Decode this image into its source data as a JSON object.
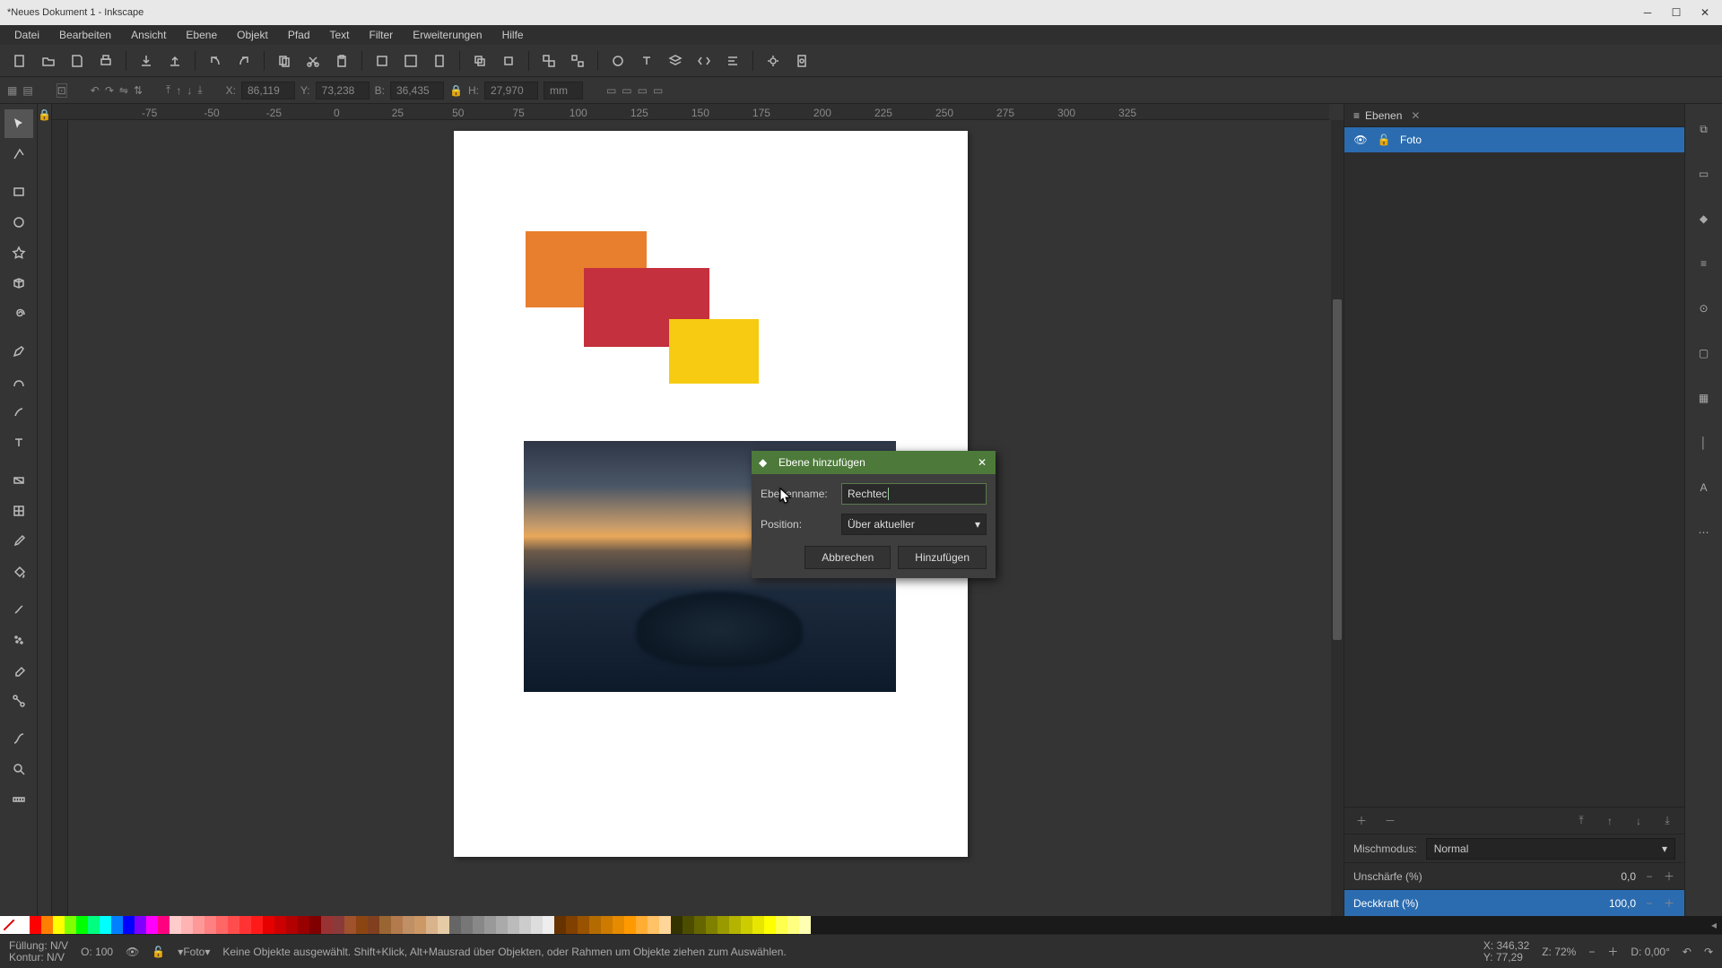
{
  "titlebar": {
    "title": "*Neues Dokument 1 - Inkscape"
  },
  "menubar": [
    "Datei",
    "Bearbeiten",
    "Ansicht",
    "Ebene",
    "Objekt",
    "Pfad",
    "Text",
    "Filter",
    "Erweiterungen",
    "Hilfe"
  ],
  "tooloptions": {
    "x_label": "X:",
    "x": "86,119",
    "y_label": "Y:",
    "y": "73,238",
    "w_label": "B:",
    "w": "36,435",
    "h_label": "H:",
    "h": "27,970",
    "unit": "mm"
  },
  "dialog": {
    "title": "Ebene hinzufügen",
    "name_label": "Ebenenname:",
    "name_value": "Rechtec",
    "pos_label": "Position:",
    "pos_value": "Über aktueller",
    "cancel": "Abbrechen",
    "ok": "Hinzufügen"
  },
  "layers_panel": {
    "tab": "Ebenen",
    "layer_name": "Foto",
    "blend_label": "Mischmodus:",
    "blend_value": "Normal",
    "blur_label": "Unschärfe (%)",
    "blur_value": "0,0",
    "opacity_label": "Deckkraft (%)",
    "opacity_value": "100,0"
  },
  "statusbar": {
    "fill_label": "Füllung:",
    "stroke_label": "Kontur:",
    "nv": "N/V",
    "o_label": "O:",
    "o_val": "100",
    "layer_sel": "▾Foto▾",
    "hint": "Keine Objekte ausgewählt. Shift+Klick, Alt+Mausrad über Objekten, oder Rahmen um Objekte ziehen zum Auswählen.",
    "coord_x_lbl": "X:",
    "coord_x": "346,32",
    "coord_y_lbl": "Y:",
    "coord_y": "77,29",
    "zoom_lbl": "Z:",
    "zoom": "72%",
    "rot_lbl": "D:",
    "rot": "0,00°"
  },
  "palette_colors": [
    "#ffffff",
    "#f00",
    "#ff8000",
    "#ff0",
    "#80ff00",
    "#0f0",
    "#00ff80",
    "#0ff",
    "#0080ff",
    "#00f",
    "#8000ff",
    "#f0f",
    "#ff0080",
    "#ffcccc",
    "#ffb3b3",
    "#ff9999",
    "#ff8080",
    "#ff6666",
    "#ff4d4d",
    "#ff3333",
    "#ff1a1a",
    "#e60000",
    "#cc0000",
    "#b30000",
    "#990000",
    "#800000",
    "#993333",
    "#8b3a3a",
    "#a0522d",
    "#8b4513",
    "#804020",
    "#996633",
    "#b37a4d",
    "#c08f66",
    "#cc9966",
    "#d9b38c",
    "#e6cca6",
    "#666666",
    "#777",
    "#888",
    "#999",
    "#aaa",
    "#bbb",
    "#ccc",
    "#ddd",
    "#eee",
    "#663300",
    "#804000",
    "#995200",
    "#b36b00",
    "#cc7a00",
    "#e68a00",
    "#ff9900",
    "#ffad33",
    "#ffc266",
    "#ffd699",
    "#333300",
    "#4d4d00",
    "#666600",
    "#808000",
    "#999900",
    "#b3b300",
    "#cccc00",
    "#e6e600",
    "#ffff00",
    "#ffff4d",
    "#ffff80",
    "#ffffb3"
  ]
}
